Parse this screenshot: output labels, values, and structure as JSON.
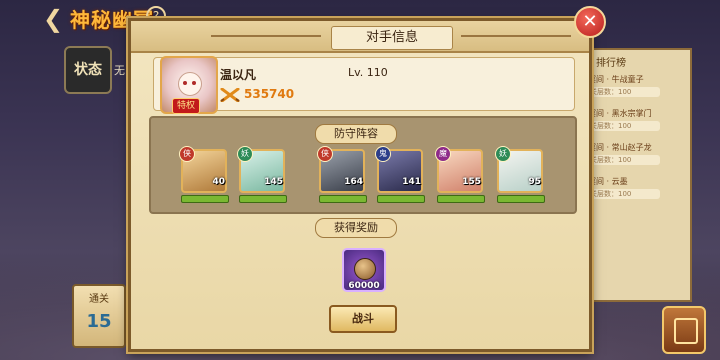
{
  "header": {
    "title": "神秘幽冥",
    "back_icon": "back-arrow-icon",
    "help_icon": "question-mark-icon"
  },
  "status": {
    "tag": "状态",
    "side_text": "无"
  },
  "ranking": {
    "title": "排行榜",
    "rows": [
      {
        "label": "冥间 · 牛战童子",
        "sub": "关层数：100"
      },
      {
        "label": "冥间 · 黑水宗掌门",
        "sub": "关层数：100"
      },
      {
        "label": "冥间 · 常山赵子龙",
        "sub": "关层数：100"
      },
      {
        "label": "冥间 · 云墨",
        "sub": "关层数：100"
      }
    ]
  },
  "level_badge": {
    "label": "通关",
    "value": "15"
  },
  "dialog": {
    "title": "对手信息",
    "close_icon": "close-x-icon",
    "opponent": {
      "name": "温以凡",
      "level": "Lv. 110",
      "power": "535740",
      "avatar_tag": "特权"
    },
    "lineup_label": "防守阵容",
    "heroes": [
      {
        "faction": "侠",
        "level": "40",
        "badge_color": "#c0392b"
      },
      {
        "faction": "妖",
        "level": "145",
        "badge_color": "#2e8b57"
      },
      {
        "faction": "侠",
        "level": "164",
        "badge_color": "#c0392b"
      },
      {
        "faction": "鬼",
        "level": "141",
        "badge_color": "#2c3e8a"
      },
      {
        "faction": "魔",
        "level": "155",
        "badge_color": "#8e2a8a"
      },
      {
        "faction": "妖",
        "level": "95",
        "badge_color": "#2e8b57"
      }
    ],
    "reward_label": "获得奖励",
    "reward": {
      "quantity": "60000",
      "icon": "coin-icon"
    },
    "fight_button": "战斗"
  }
}
